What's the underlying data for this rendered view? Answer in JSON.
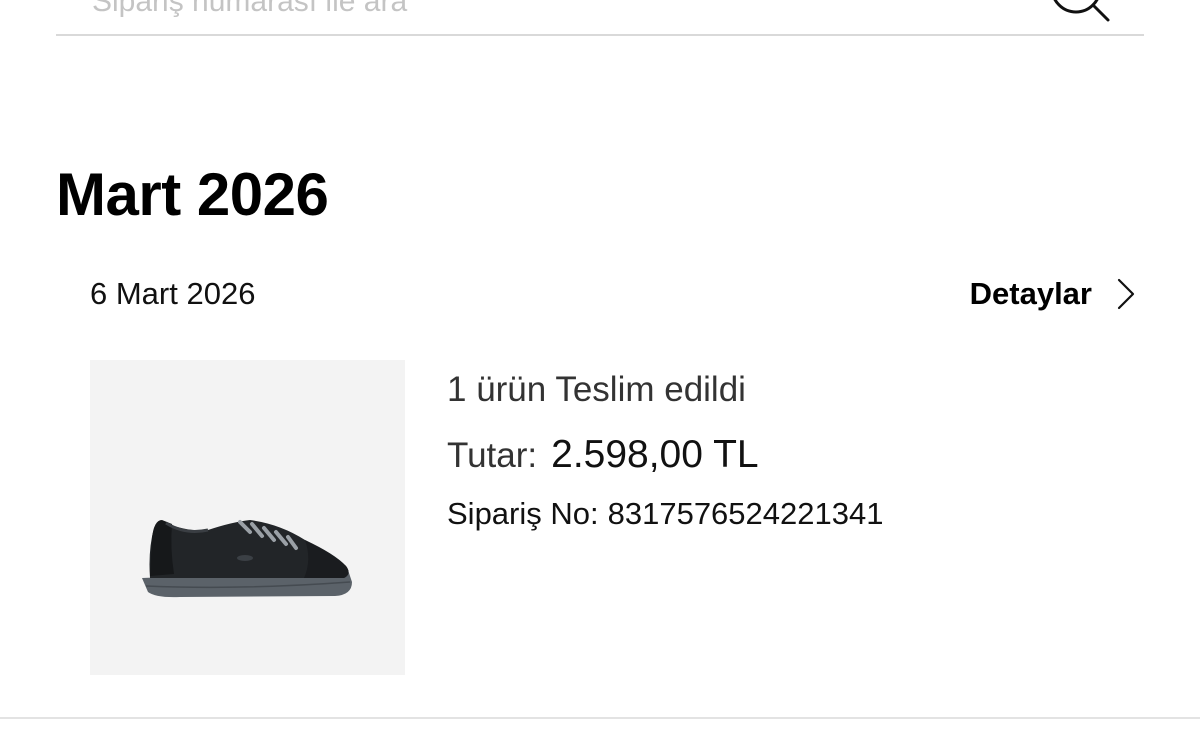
{
  "search": {
    "placeholder": "Sipariş numarası ile ara",
    "icon": "search-icon"
  },
  "month_group": {
    "heading": "Mart 2026"
  },
  "order": {
    "date": "6 Mart 2026",
    "details_label": "Detaylar",
    "details_icon": "chevron-right-icon",
    "status": "1 ürün Teslim edildi",
    "amount_label": "Tutar:",
    "amount_value": "2.598,00 TL",
    "order_no_label": "Sipariş No:",
    "order_no_value": "8317576524221341",
    "product_image": "black-sneaker-image"
  },
  "colors": {
    "background": "#ffffff",
    "text": "#111111",
    "placeholder": "#c4c4c4",
    "divider": "#d9d9d9",
    "image_background": "#f3f3f3"
  }
}
